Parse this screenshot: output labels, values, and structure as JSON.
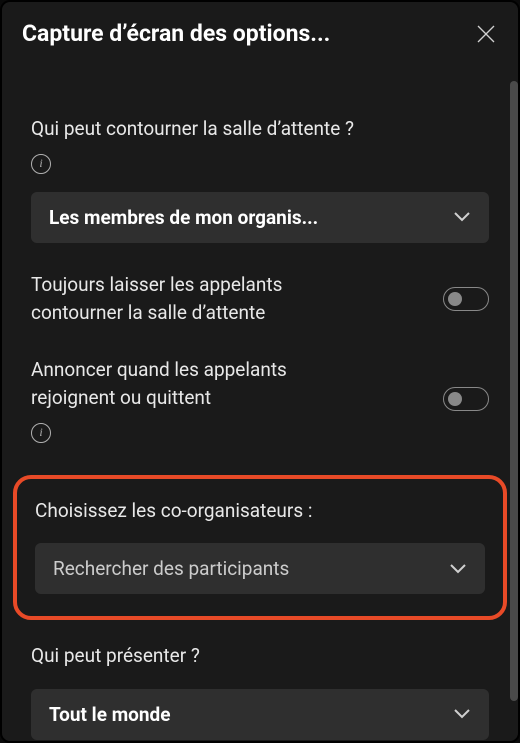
{
  "header": {
    "title": "Capture d’écran des options..."
  },
  "sections": {
    "bypass_lobby": {
      "label": "Qui peut contourner la salle d’attente ?",
      "dropdown_value": "Les membres de mon organis..."
    },
    "always_let_callers": {
      "label": "Toujours laisser les appelants contourner la salle d’attente"
    },
    "announce_callers": {
      "label": "Annoncer quand les appelants rejoignent ou quittent"
    },
    "co_organizers": {
      "label": "Choisissez les co-organisateurs :",
      "placeholder": "Rechercher des participants"
    },
    "who_present": {
      "label": "Qui peut présenter ?",
      "dropdown_value": "Tout le monde"
    }
  }
}
